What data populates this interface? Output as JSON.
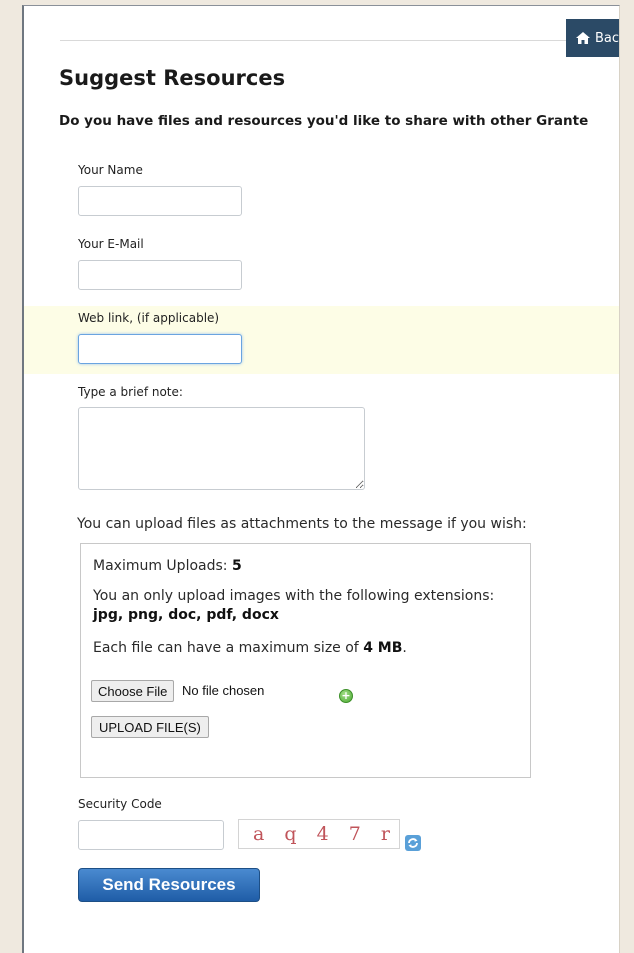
{
  "header": {
    "back_label": "Bac",
    "title": "Suggest Resources",
    "intro": "Do you have files and resources you'd like to share with other Grante"
  },
  "form": {
    "name_label": "Your Name",
    "name_value": "",
    "email_label": "Your E-Mail",
    "email_value": "",
    "link_label": "Web link, (if applicable)",
    "link_value": "",
    "note_label": "Type a brief note:",
    "note_value": ""
  },
  "upload": {
    "intro": "You can upload files as attachments to the message if you wish:",
    "max_label": "Maximum Uploads: ",
    "max_value": "5",
    "ext_text": "You an only upload images with the following extensions:",
    "ext_list": "jpg, png, doc, pdf, docx",
    "size_text": "Each file can have a maximum size of ",
    "size_value": "4 MB",
    "size_end": ".",
    "choose_label": "Choose File",
    "no_file_text": "No file chosen",
    "upload_label": "UPLOAD FILE(S)"
  },
  "security": {
    "label": "Security Code",
    "value": "",
    "captcha_text": "a q 4 7 r"
  },
  "submit_label": "Send Resources",
  "colors": {
    "back_button": "#2b4a66",
    "send_button": "#1f5da7",
    "highlight_row": "#fdfde6",
    "captcha_text": "#c0545a"
  },
  "icons": {
    "back": "home-icon",
    "add": "add-circle-icon",
    "refresh": "refresh-icon"
  }
}
